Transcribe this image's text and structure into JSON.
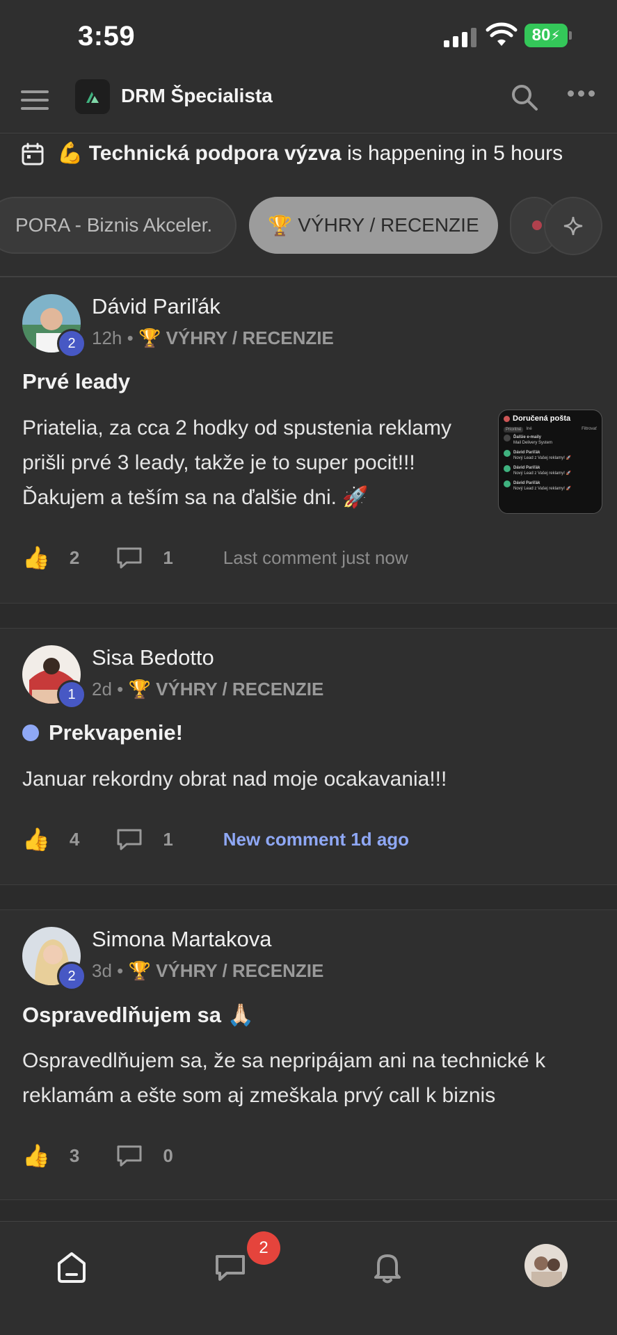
{
  "status_bar": {
    "time": "3:59",
    "battery": "80"
  },
  "header": {
    "title": "DRM Špecialista"
  },
  "banner": {
    "emoji": "💪",
    "event_name": "Technická podpora výzva",
    "suffix": " is happening in 5 hours"
  },
  "pills": [
    {
      "label": "PORA - Biznis Akceler."
    },
    {
      "emoji": "🏆",
      "label": "VÝHRY / RECENZIE"
    }
  ],
  "posts": [
    {
      "author": "Dávid Pariľák",
      "level": "2",
      "time": "12h",
      "category_emoji": "🏆",
      "category": "VÝHRY / RECENZIE",
      "title": "Prvé leady",
      "body": "Priatelia, za cca 2 hodky od spustenia reklamy prišli prvé 3 leady, takže je to super pocit!!! Ďakujem a teším sa na ďalšie dni. 🚀",
      "likes": "2",
      "comments": "1",
      "comment_status": "Last comment just now",
      "thumbnail": {
        "title": "Doručená pošta",
        "tabs": [
          "Prioritné",
          "Iné",
          "Filtrovať"
        ],
        "rows": [
          {
            "name": "Ďalšie e-maily",
            "text": "Mail Delivery System"
          },
          {
            "name": "Dávid Pariľák",
            "text": "Nový Lead z Vašej reklamy! 🚀"
          },
          {
            "name": "Dávid Pariľák",
            "text": "Nový Lead z Vašej reklamy! 🚀"
          },
          {
            "name": "Dávid Pariľák",
            "text": "Nový Lead z Vašej reklamy! 🚀"
          }
        ]
      }
    },
    {
      "author": "Sisa Bedotto",
      "level": "1",
      "time": "2d",
      "category_emoji": "🏆",
      "category": "VÝHRY / RECENZIE",
      "title": "Prekvapenie!",
      "body": "Januar rekordny obrat nad moje ocakavania!!!",
      "likes": "4",
      "comments": "1",
      "comment_status": "New comment 1d ago"
    },
    {
      "author": "Simona Martakova",
      "level": "2",
      "time": "3d",
      "category_emoji": "🏆",
      "category": "VÝHRY / RECENZIE",
      "title": "Ospravedlňujem sa 🙏🏻",
      "body": "Ospravedlňujem sa, že sa nepripájam ani na technické k reklamám a ešte som aj zmeškala prvý call k biznis",
      "likes": "3",
      "comments": "0"
    }
  ],
  "bottom_nav": {
    "chat_badge": "2"
  },
  "colors": {
    "accent_blue": "#8fa8f5",
    "badge_blue": "#4758c4",
    "notification_red": "#e5443c",
    "battery_green": "#34c759"
  }
}
